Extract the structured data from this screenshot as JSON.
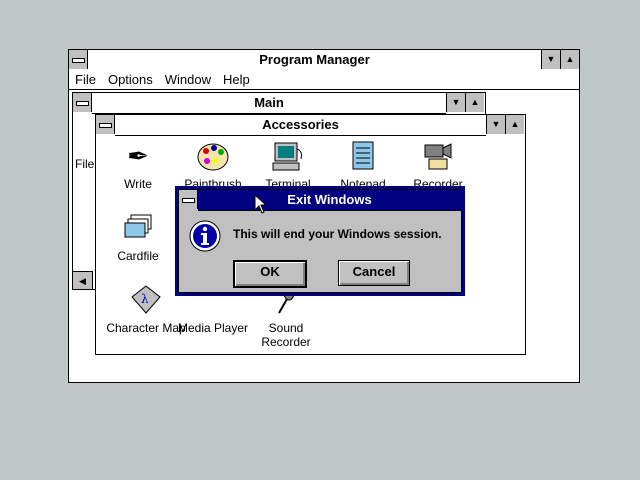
{
  "program_manager": {
    "title": "Program Manager",
    "menu": [
      "File",
      "Options",
      "Window",
      "Help"
    ]
  },
  "main_group": {
    "title": "Main",
    "partial_label_file": "File"
  },
  "accessories": {
    "title": "Accessories",
    "icons": [
      {
        "label": "Write",
        "icon": "write-pen-icon"
      },
      {
        "label": "Paintbrush",
        "icon": "palette-icon"
      },
      {
        "label": "Terminal",
        "icon": "terminal-icon"
      },
      {
        "label": "Notepad",
        "icon": "notepad-icon"
      },
      {
        "label": "Recorder",
        "icon": "recorder-icon"
      },
      {
        "label": "Cardfile",
        "icon": "cardfile-icon"
      },
      {
        "label": "Character Map",
        "icon": "character-map-icon"
      },
      {
        "label": "Media Player",
        "icon": "media-player-icon"
      },
      {
        "label": "Sound Recorder",
        "icon": "sound-recorder-icon"
      }
    ]
  },
  "dialog": {
    "title": "Exit Windows",
    "message": "This will end your Windows session.",
    "ok_label": "OK",
    "cancel_label": "Cancel",
    "icon": "info-icon"
  },
  "colors": {
    "desktop": "#c0c7c8",
    "active_title": "#000080"
  }
}
